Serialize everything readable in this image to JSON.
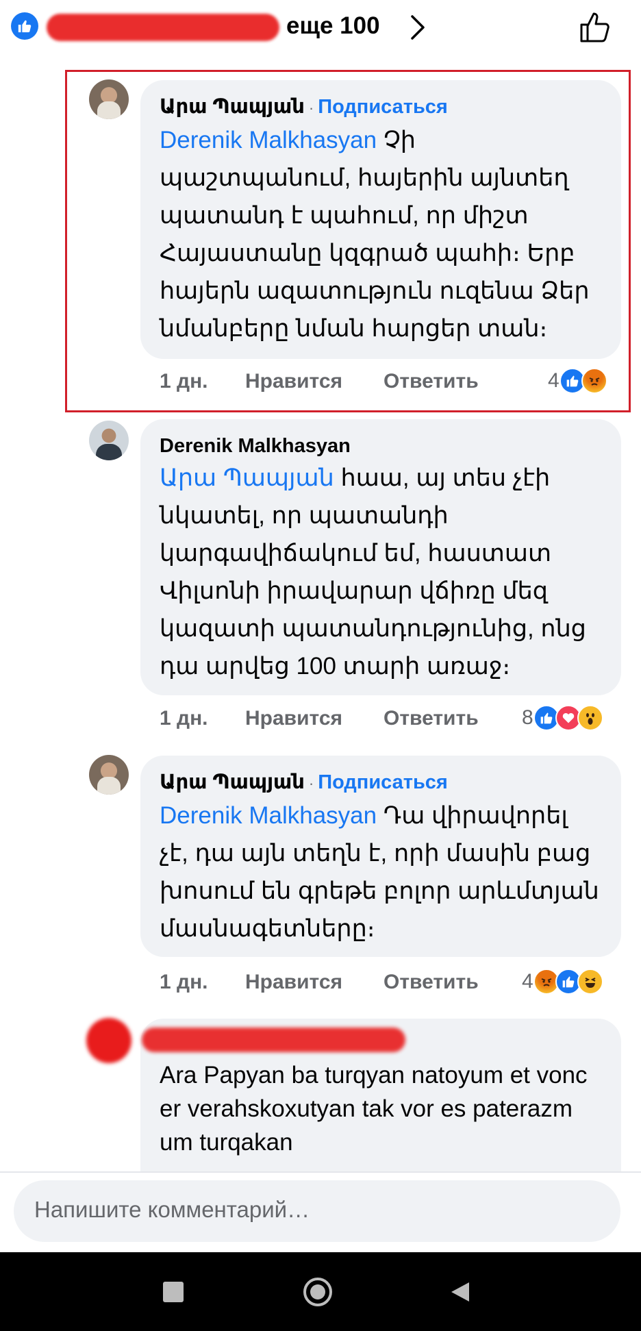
{
  "top_bar": {
    "more_label": "еще 100"
  },
  "comments": [
    {
      "author": "Արա Պապյան",
      "separator": "·",
      "subscribe": "Подписаться",
      "mention": "Derenik Malkhasyan",
      "text": " Չի պաշտպանում, հայերին այնտեղ պատանդ է պահում, որ միշտ Հայաստանը կզգրած պահի։ Երբ հայերն ազատություն ուզենա Ձեր նմանբերը նման հարցեր տան։",
      "time": "1 дн.",
      "like": "Нравится",
      "reply": "Ответить",
      "reaction_count": "4",
      "reactions": [
        "like-icon",
        "angry-icon"
      ]
    },
    {
      "author": "Derenik Malkhasyan",
      "mention": "Արա Պապյան",
      "text": " հաա, այ տես չէի նկատել, որ պատանդի կարգավիճակում եմ, հաստատ Վիլսոնի իրավարար վճիռը մեզ կազատի պատանդությունից, ոնց դա արվեց 100 տարի առաջ։",
      "time": "1 дн.",
      "like": "Нравится",
      "reply": "Ответить",
      "reaction_count": "8",
      "reactions": [
        "like-icon",
        "love-icon",
        "wow-icon"
      ]
    },
    {
      "author": "Արա Պապյան",
      "separator": "·",
      "subscribe": "Подписаться",
      "mention": "Derenik Malkhasyan",
      "text": " Դա վիրավորել չէ, դա այն տեղն է, որի մասին բաց խոսում են գրեթե բոլոր արևմտյան մասնագետները։",
      "time": "1 дн.",
      "like": "Нравится",
      "reply": "Ответить",
      "reaction_count": "4",
      "reactions": [
        "angry-icon",
        "like-icon",
        "haha-icon"
      ]
    },
    {
      "text": "Ara Papyan ba turqyan natoyum et vonc er verahskoxutyan tak vor es paterazm um turqakan"
    }
  ],
  "composer": {
    "placeholder": "Напишите комментарий…"
  },
  "colors": {
    "accent": "#1877f2",
    "bubble": "#f0f2f5",
    "highlight": "#d11f2a",
    "muted": "#65676b"
  }
}
